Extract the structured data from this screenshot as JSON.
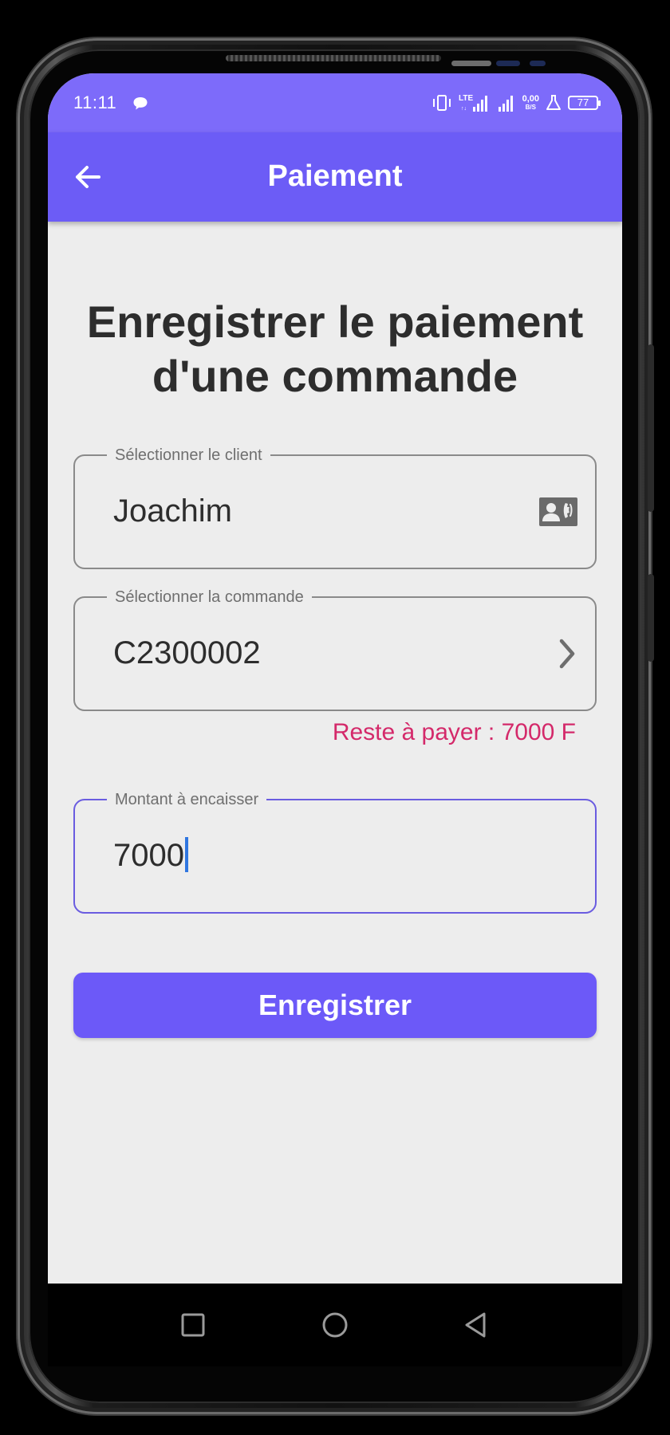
{
  "status_bar": {
    "time": "11:11",
    "network": "LTE",
    "speed": "0,00",
    "speed_unit": "B/S",
    "battery": "77"
  },
  "app_bar": {
    "title": "Paiement",
    "back_icon": "arrow-left-icon"
  },
  "heading": {
    "line1": "Enregistrer le paiement",
    "line2": "d'une commande"
  },
  "form": {
    "client": {
      "label": "Sélectionner le client",
      "value": "Joachim",
      "icon": "contact-phone-icon"
    },
    "order": {
      "label": "Sélectionner la commande",
      "value": "C2300002",
      "icon": "chevron-right-icon"
    },
    "remaining_text": "Reste à payer : 7000 F",
    "amount": {
      "label": "Montant à encaisser",
      "value": "7000"
    },
    "submit_label": "Enregistrer"
  },
  "nav_bar": {
    "recents_icon": "square-icon",
    "home_icon": "circle-icon",
    "back_icon": "triangle-back-icon"
  },
  "colors": {
    "primary": "#6c5cf6",
    "status_bar": "#7d6bfa",
    "background": "#ededed",
    "error_text": "#d4296a",
    "caret": "#2f76e0"
  }
}
